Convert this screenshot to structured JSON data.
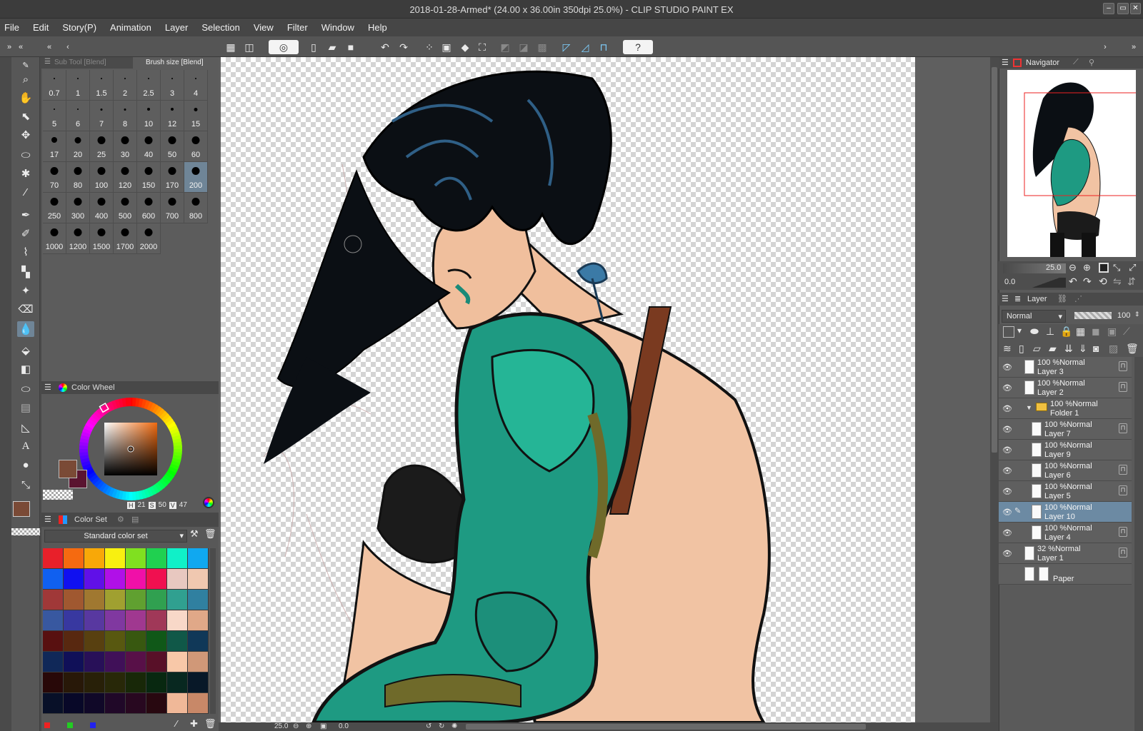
{
  "window": {
    "title": "2018-01-28-Armed* (24.00 x 36.00in 350dpi 25.0%)  - CLIP STUDIO PAINT EX"
  },
  "menu": [
    "File",
    "Edit",
    "Story(P)",
    "Animation",
    "Layer",
    "Selection",
    "View",
    "Filter",
    "Window",
    "Help"
  ],
  "icons": {
    "help": "help-icon",
    "snap": "snap-icon"
  },
  "subtool": {
    "tab1": "Sub Tool [Blend]",
    "tab2": "Brush size [Blend]"
  },
  "brush_sizes": [
    {
      "label": "0.7",
      "dot": 1
    },
    {
      "label": "1",
      "dot": 1
    },
    {
      "label": "1.5",
      "dot": 1
    },
    {
      "label": "2",
      "dot": 1
    },
    {
      "label": "2.5",
      "dot": 1
    },
    {
      "label": "3",
      "dot": 1
    },
    {
      "label": "4",
      "dot": 2
    },
    {
      "label": "5",
      "dot": 2
    },
    {
      "label": "6",
      "dot": 2
    },
    {
      "label": "7",
      "dot": 3
    },
    {
      "label": "8",
      "dot": 3
    },
    {
      "label": "10",
      "dot": 4
    },
    {
      "label": "12",
      "dot": 4
    },
    {
      "label": "15",
      "dot": 5
    },
    {
      "label": "17",
      "dot": 8
    },
    {
      "label": "20",
      "dot": 9
    },
    {
      "label": "25",
      "dot": 11
    },
    {
      "label": "30",
      "dot": 11
    },
    {
      "label": "40",
      "dot": 11
    },
    {
      "label": "50",
      "dot": 11
    },
    {
      "label": "60",
      "dot": 11
    },
    {
      "label": "70",
      "dot": 11
    },
    {
      "label": "80",
      "dot": 11
    },
    {
      "label": "100",
      "dot": 11
    },
    {
      "label": "120",
      "dot": 11
    },
    {
      "label": "150",
      "dot": 11
    },
    {
      "label": "170",
      "dot": 11
    },
    {
      "label": "200",
      "dot": 11,
      "selected": true
    },
    {
      "label": "250",
      "dot": 11
    },
    {
      "label": "300",
      "dot": 11
    },
    {
      "label": "400",
      "dot": 11
    },
    {
      "label": "500",
      "dot": 11
    },
    {
      "label": "600",
      "dot": 11
    },
    {
      "label": "700",
      "dot": 11
    },
    {
      "label": "800",
      "dot": 11
    },
    {
      "label": "1000",
      "dot": 11
    },
    {
      "label": "1200",
      "dot": 11
    },
    {
      "label": "1500",
      "dot": 11
    },
    {
      "label": "1700",
      "dot": 11
    },
    {
      "label": "2000",
      "dot": 11
    }
  ],
  "color_wheel": {
    "title": "Color Wheel",
    "h_label": "H",
    "h": "21",
    "s_label": "S",
    "s": "50",
    "v_label": "V",
    "v": "47",
    "main_color": "#7a4a36",
    "sub_color": "#5a1430"
  },
  "color_set": {
    "title": "Color Set",
    "selected": "Standard color set",
    "colors": [
      "#e8202a",
      "#f56a10",
      "#f8a808",
      "#f8f010",
      "#80e020",
      "#20d050",
      "#10f0c8",
      "#10a8f0",
      "#1060f0",
      "#1010f0",
      "#6010e8",
      "#b010e8",
      "#f010a8",
      "#f01050",
      "#e8c8c0",
      "#f0c8b0",
      "#a03838",
      "#a05830",
      "#a07830",
      "#a0a030",
      "#60a030",
      "#30a050",
      "#30a090",
      "#3080a0",
      "#3858a0",
      "#3838a0",
      "#5838a0",
      "#8038a0",
      "#a03890",
      "#a03858",
      "#f8d8c8",
      "#e0a888",
      "#581010",
      "#582810",
      "#584010",
      "#585810",
      "#385810",
      "#105818",
      "#105848",
      "#103858",
      "#102858",
      "#101058",
      "#281058",
      "#401058",
      "#581048",
      "#581028",
      "#f8c8a8",
      "#d09878",
      "#280808",
      "#281808",
      "#282008",
      "#282808",
      "#182808",
      "#082810",
      "#082820",
      "#081828",
      "#081028",
      "#080828",
      "#100828",
      "#200828",
      "#280820",
      "#280810",
      "#f0b898",
      "#c88868"
    ]
  },
  "navigator": {
    "title": "Navigator",
    "zoom": "25.0",
    "rotation": "0.0"
  },
  "layer_panel": {
    "title": "Layer",
    "blend_mode": "Normal",
    "opacity": "100"
  },
  "layers": [
    {
      "mode": "100 %Normal",
      "name": "Layer 3",
      "indent": 0,
      "lock": true
    },
    {
      "mode": "100 %Normal",
      "name": "Layer 2",
      "indent": 0,
      "lock": true
    },
    {
      "mode": "100 %Normal",
      "name": "Folder 1",
      "indent": 0,
      "folder": true
    },
    {
      "mode": "100 %Normal",
      "name": "Layer 7",
      "indent": 1,
      "lock": true
    },
    {
      "mode": "100 %Normal",
      "name": "Layer 9",
      "indent": 1
    },
    {
      "mode": "100 %Normal",
      "name": "Layer 6",
      "indent": 1,
      "lock": true
    },
    {
      "mode": "100 %Normal",
      "name": "Layer 5",
      "indent": 1,
      "lock": true
    },
    {
      "mode": "100 %Normal",
      "name": "Layer 10",
      "indent": 1,
      "selected": true
    },
    {
      "mode": "100 %Normal",
      "name": "Layer 4",
      "indent": 1,
      "lock": true
    },
    {
      "mode": "32 %Normal",
      "name": "Layer 1",
      "indent": 0,
      "lock": true
    },
    {
      "mode": "",
      "name": "Paper",
      "indent": 0,
      "paper": true
    }
  ],
  "statusbar": {
    "zoom": "25.0",
    "angle": "0.0"
  }
}
